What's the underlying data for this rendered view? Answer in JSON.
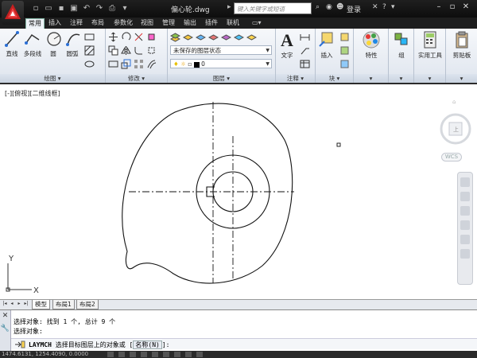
{
  "window": {
    "title": "偏心轮.dwg",
    "search_placeholder": "键入关键字或短语",
    "login_label": "登录"
  },
  "qat_icons": [
    "new-file-icon",
    "open-file-icon",
    "save-icon",
    "undo-icon",
    "redo-icon",
    "plot-icon",
    "dropdown-icon"
  ],
  "ribbon_tabs": [
    {
      "label": "常用",
      "active": true
    },
    {
      "label": "插入",
      "active": false
    },
    {
      "label": "注释",
      "active": false
    },
    {
      "label": "布局",
      "active": false
    },
    {
      "label": "参数化",
      "active": false
    },
    {
      "label": "视图",
      "active": false
    },
    {
      "label": "管理",
      "active": false
    },
    {
      "label": "输出",
      "active": false
    },
    {
      "label": "插件",
      "active": false
    },
    {
      "label": "联机",
      "active": false
    }
  ],
  "ribbon": {
    "draw": {
      "label": "绘图",
      "line": "直线",
      "polyline": "多段线",
      "circle": "圆",
      "arc": "圆弧"
    },
    "modify": {
      "label": "修改"
    },
    "layers": {
      "label": "图层",
      "layer_state": "未保存的图层状态",
      "current_layer": "0"
    },
    "annotation": {
      "label": "注释",
      "text": "文字"
    },
    "block": {
      "label": "块",
      "insert": "插入"
    },
    "properties": {
      "label": "特性"
    },
    "groups": {
      "label": "组"
    },
    "utilities": {
      "label": "实用工具"
    },
    "clipboard": {
      "label": "剪贴板"
    }
  },
  "viewport": {
    "label": "[-][俯视][二维线框]",
    "wcs": "WCS",
    "ucs_x": "X",
    "ucs_y": "Y"
  },
  "layout_tabs": [
    {
      "label": "模型",
      "active": true
    },
    {
      "label": "布局1",
      "active": false
    },
    {
      "label": "布局2",
      "active": false
    }
  ],
  "command": {
    "history": [
      "选择对象: 找到 1 个, 总计 9 个",
      "选择对象:"
    ],
    "prompt_cmd": "LAYMCH",
    "prompt_text": "选择目标图层上的对象或 [",
    "prompt_option": "名称(N)",
    "prompt_end": "]:"
  },
  "status": {
    "coords": "1474.6131, 1254.4090, 0.0000"
  }
}
